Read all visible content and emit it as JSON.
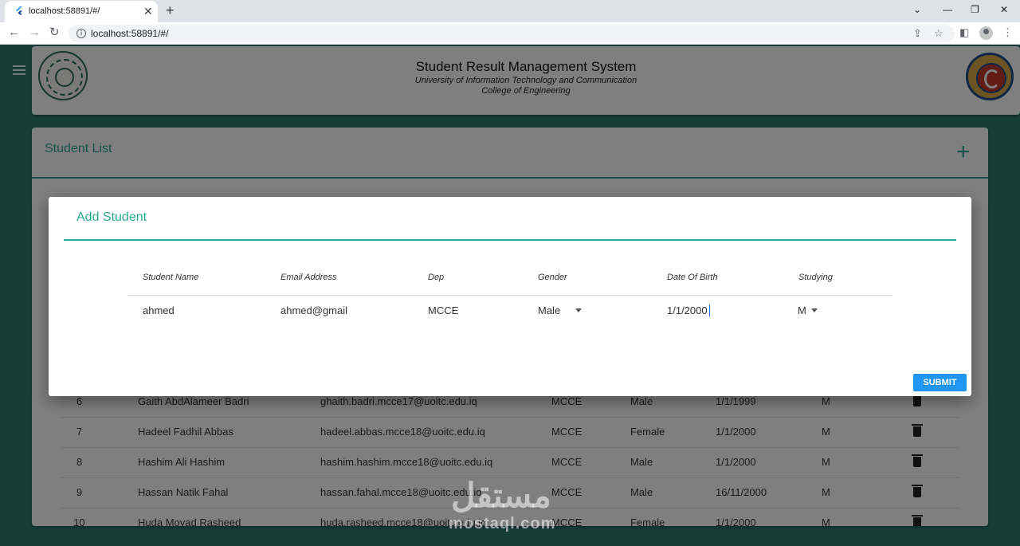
{
  "browser": {
    "tab_title": "localhost:58891/#/",
    "url": "localhost:58891/#/",
    "new_tab": "+",
    "close": "✕"
  },
  "header": {
    "title": "Student Result Management System",
    "subtitle1": "University of Information Technology and Communication",
    "subtitle2": "College of Engineering"
  },
  "student_list": {
    "title": "Student List",
    "add_icon": "+",
    "rows": [
      {
        "id": "6",
        "name": "Gaith AbdAlameer Badri",
        "email": "ghaith.badri.mcce17@uoitc.edu.iq",
        "dep": "MCCE",
        "gender": "Male",
        "dob": "1/1/1999",
        "studying": "M"
      },
      {
        "id": "7",
        "name": "Hadeel Fadhil Abbas",
        "email": "hadeel.abbas.mcce18@uoitc.edu.iq",
        "dep": "MCCE",
        "gender": "Female",
        "dob": "1/1/2000",
        "studying": "M"
      },
      {
        "id": "8",
        "name": "Hashim Ali Hashim",
        "email": "hashim.hashim.mcce18@uoitc.edu.iq",
        "dep": "MCCE",
        "gender": "Male",
        "dob": "1/1/2000",
        "studying": "M"
      },
      {
        "id": "9",
        "name": "Hassan Natik Fahal",
        "email": "hassan.fahal.mcce18@uoitc.edu.iq",
        "dep": "MCCE",
        "gender": "Male",
        "dob": "16/11/2000",
        "studying": "M"
      },
      {
        "id": "10",
        "name": "Huda Moyad Rasheed",
        "email": "huda.rasheed.mcce18@uoitc.edu.iq",
        "dep": "MCCE",
        "gender": "Female",
        "dob": "1/1/2000",
        "studying": "M"
      }
    ]
  },
  "dialog": {
    "title": "Add Student",
    "columns": [
      "Student Name",
      "Email Address",
      "Dep",
      "Gender",
      "Date Of Birth",
      "Studying"
    ],
    "values": {
      "name": "ahmed",
      "email": "ahmed@gmail",
      "dep": "MCCE",
      "gender": "Male",
      "dob": "1/1/2000",
      "studying": "M"
    },
    "submit_label": "SUBMIT"
  },
  "watermark": {
    "arabic": "مستقل",
    "latin": "mostaql.com"
  },
  "colors": {
    "background": "#2d7d6f",
    "accent": "#2da893",
    "submit": "#2196f3"
  }
}
